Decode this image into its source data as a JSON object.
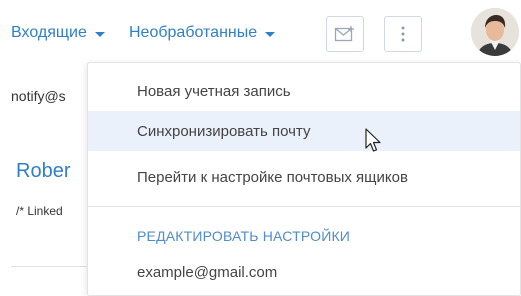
{
  "header": {
    "inbox_label": "Входящие",
    "filter_label": "Необработанные",
    "compose_icon": "envelope-icon",
    "more_icon": "vertical-ellipsis-icon"
  },
  "background": {
    "sender_email": "notify@s",
    "contact_name": "Rober",
    "comment": "/* Linked"
  },
  "menu": {
    "items": [
      {
        "label": "Новая учетная запись"
      },
      {
        "label": "Синхронизировать почту"
      },
      {
        "label": "Перейти к настройке почтовых ящиков"
      }
    ],
    "section_header": "РЕДАКТИРОВАТЬ НАСТРОЙКИ",
    "accounts": [
      {
        "label": "example@gmail.com"
      }
    ]
  },
  "colors": {
    "link": "#2f80c8",
    "hover_bg": "#eaf1fa",
    "section_header": "#4f8cc9"
  }
}
